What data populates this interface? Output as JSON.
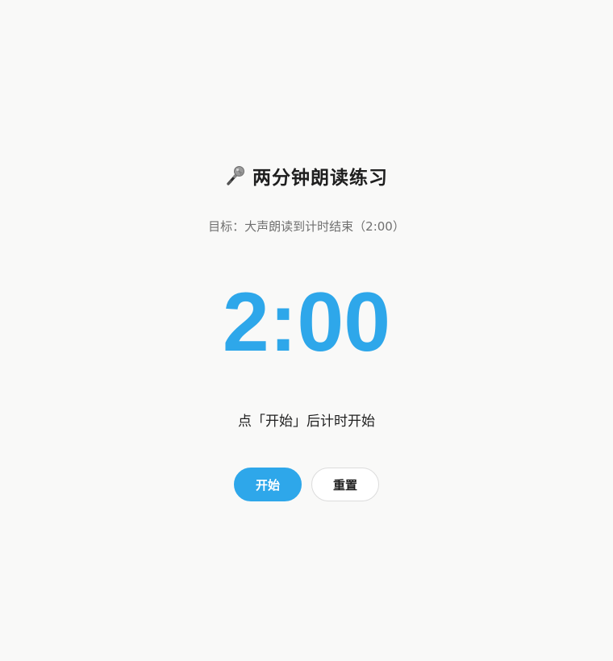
{
  "header": {
    "icon": "microphone-icon",
    "title": "两分钟朗读练习"
  },
  "goal_text": "目标：大声朗读到计时结束（2:00）",
  "timer": {
    "display": "2:00"
  },
  "hint_text": "点「开始」后计时开始",
  "buttons": {
    "start_label": "开始",
    "reset_label": "重置"
  },
  "colors": {
    "accent": "#2ea7ea",
    "background": "#f9f9f8",
    "text": "#1f1f1f",
    "muted": "#707070"
  }
}
